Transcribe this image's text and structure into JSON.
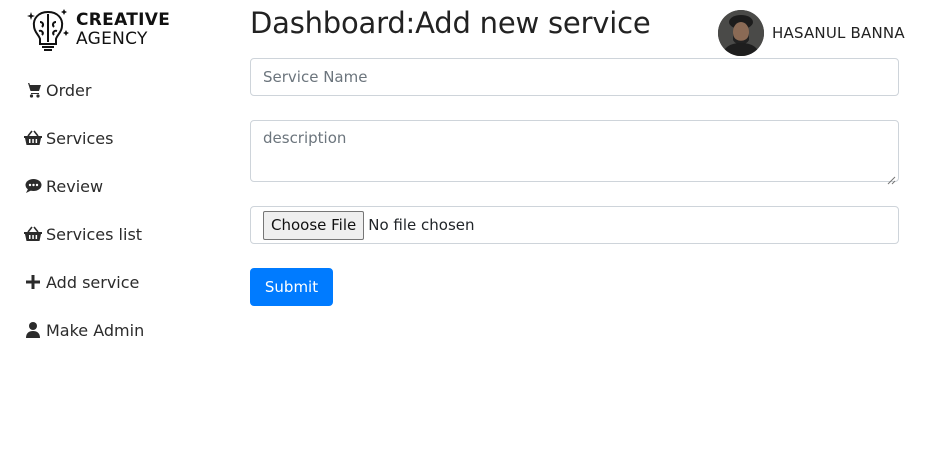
{
  "brand": {
    "line1": "CREATIVE",
    "line2": "AGENCY",
    "icon": "brain-bulb-icon"
  },
  "sidebar": {
    "items": [
      {
        "label": "Order",
        "icon": "cart-icon"
      },
      {
        "label": "Services",
        "icon": "basket-icon"
      },
      {
        "label": "Review",
        "icon": "comment-icon"
      },
      {
        "label": "Services list",
        "icon": "basket-icon"
      },
      {
        "label": "Add service",
        "icon": "plus-icon"
      },
      {
        "label": "Make Admin",
        "icon": "user-icon"
      }
    ]
  },
  "header": {
    "title": "Dashboard:Add new service",
    "user_name": "HASANUL BANNA"
  },
  "form": {
    "service_name": {
      "value": "",
      "placeholder": "Service Name"
    },
    "description": {
      "value": "",
      "placeholder": "description"
    },
    "file": {
      "button_label": "Choose File",
      "status": "No file chosen"
    },
    "submit_label": "Submit"
  },
  "colors": {
    "primary": "#007bff",
    "border": "#ced4da",
    "text": "#212529"
  }
}
